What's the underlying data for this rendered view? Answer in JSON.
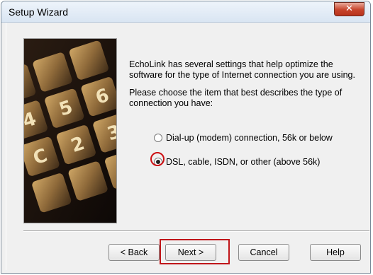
{
  "window": {
    "title": "Setup Wizard",
    "close_glyph": "✕"
  },
  "intro": {
    "paragraph1": "EchoLink has several settings that help optimize the software for the type of Internet connection you are using.",
    "paragraph2": "Please choose the item that best describes the type of connection you have:"
  },
  "options": [
    {
      "label": "Dial-up (modem) connection, 56k or below",
      "selected": false
    },
    {
      "label": "DSL, cable, ISDN, or other (above 56k)",
      "selected": true
    }
  ],
  "buttons": {
    "back": "< Back",
    "next": "Next >",
    "cancel": "Cancel",
    "help": "Help"
  },
  "photo": {
    "key_labels": [
      "4",
      "5",
      "6",
      "C",
      "2",
      "3"
    ]
  },
  "colors": {
    "highlight": "#cc0f12",
    "close_button": "#c7442b"
  }
}
